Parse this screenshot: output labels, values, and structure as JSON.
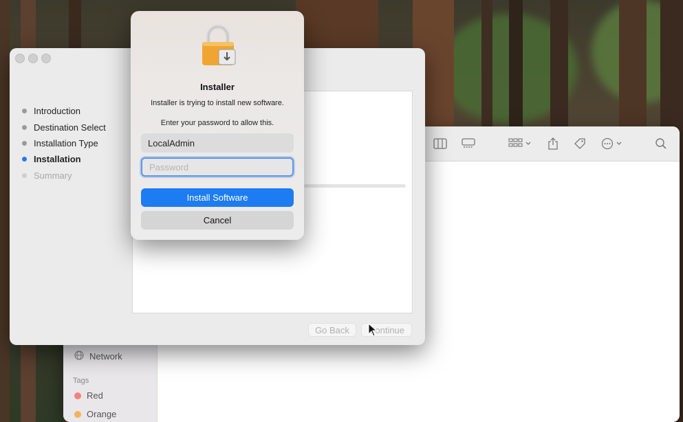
{
  "finder": {
    "sidebar": {
      "network_label": "Network",
      "tags_header": "Tags",
      "tags": [
        {
          "label": "Red",
          "color": "#f2817e"
        },
        {
          "label": "Orange",
          "color": "#f3b25e"
        }
      ]
    },
    "toolbar_icons": [
      "columns-view-icon",
      "gallery-view-icon",
      "group-icon",
      "share-icon",
      "tag-icon",
      "more-icon",
      "search-icon"
    ]
  },
  "installer": {
    "steps": [
      {
        "label": "Introduction",
        "state": "done"
      },
      {
        "label": "Destination Select",
        "state": "done"
      },
      {
        "label": "Installation Type",
        "state": "done"
      },
      {
        "label": "Installation",
        "state": "active"
      },
      {
        "label": "Summary",
        "state": "future"
      }
    ],
    "go_back_label": "Go Back",
    "continue_label": "Continue"
  },
  "auth_dialog": {
    "title": "Installer",
    "message": "Installer is trying to install new software.",
    "prompt": "Enter your password to allow this.",
    "username_value": "LocalAdmin",
    "password_placeholder": "Password",
    "install_label": "Install Software",
    "cancel_label": "Cancel"
  },
  "colors": {
    "accent": "#1e7cf2",
    "lock": "#f0a532"
  }
}
